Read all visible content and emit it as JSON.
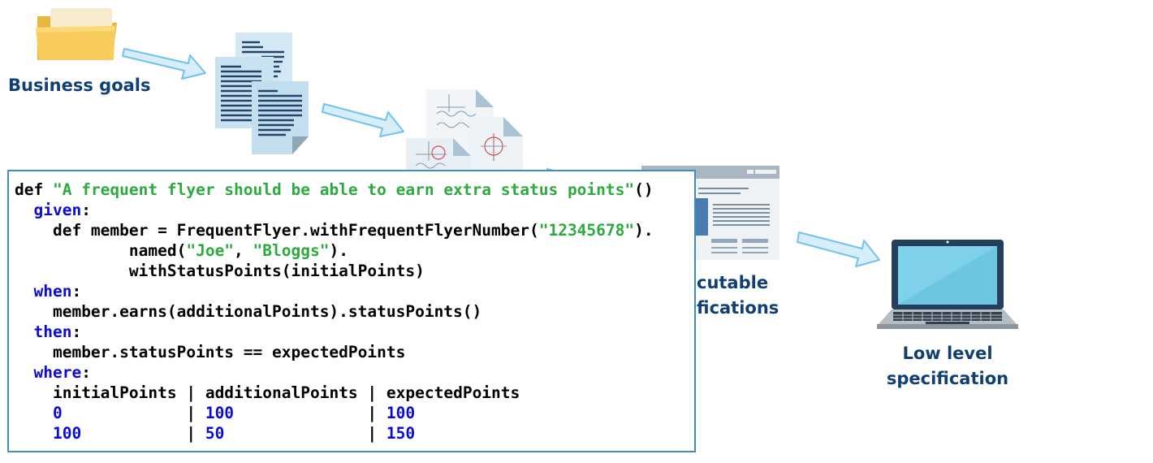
{
  "stages": {
    "business_goals": "Business goals",
    "executable_specifications": [
      "cutable",
      "fications"
    ],
    "low_level_specification": [
      "Low level",
      "specification"
    ]
  },
  "code": {
    "def_keyword": "def",
    "title_string": "\"A frequent flyer should be able to earn extra status points\"",
    "parens": "()",
    "given": "given",
    "when": "when",
    "then": "then",
    "where": "where",
    "member_prefix": "def member = FrequentFlyer.withFrequentFlyerNumber(",
    "ff_number": "\"12345678\"",
    "named_prefix": "named(",
    "first_name": "\"Joe\"",
    "last_name": "\"Bloggs\"",
    "with_status": "withStatusPoints(initialPoints)",
    "earns_line": "member.earns(additionalPoints).statusPoints()",
    "expect_line": "member.statusPoints == expectedPoints",
    "table_header": [
      "initialPoints",
      "additionalPoints",
      "expectedPoints"
    ],
    "table_rows": [
      [
        "0",
        "100",
        "100"
      ],
      [
        "100",
        "50",
        "150"
      ]
    ]
  },
  "colors": {
    "label": "#0f3f73",
    "keyword": "#0b0bd4",
    "string": "#2daa3f",
    "arrow_fill": "#d6eef9",
    "arrow_stroke": "#73c2ec",
    "box_border": "#3d8fbd"
  },
  "icons": [
    "folder-icon",
    "document-stack-icon",
    "sketch-documents-icon",
    "browser-window-icon",
    "laptop-icon",
    "arrow-icon"
  ]
}
